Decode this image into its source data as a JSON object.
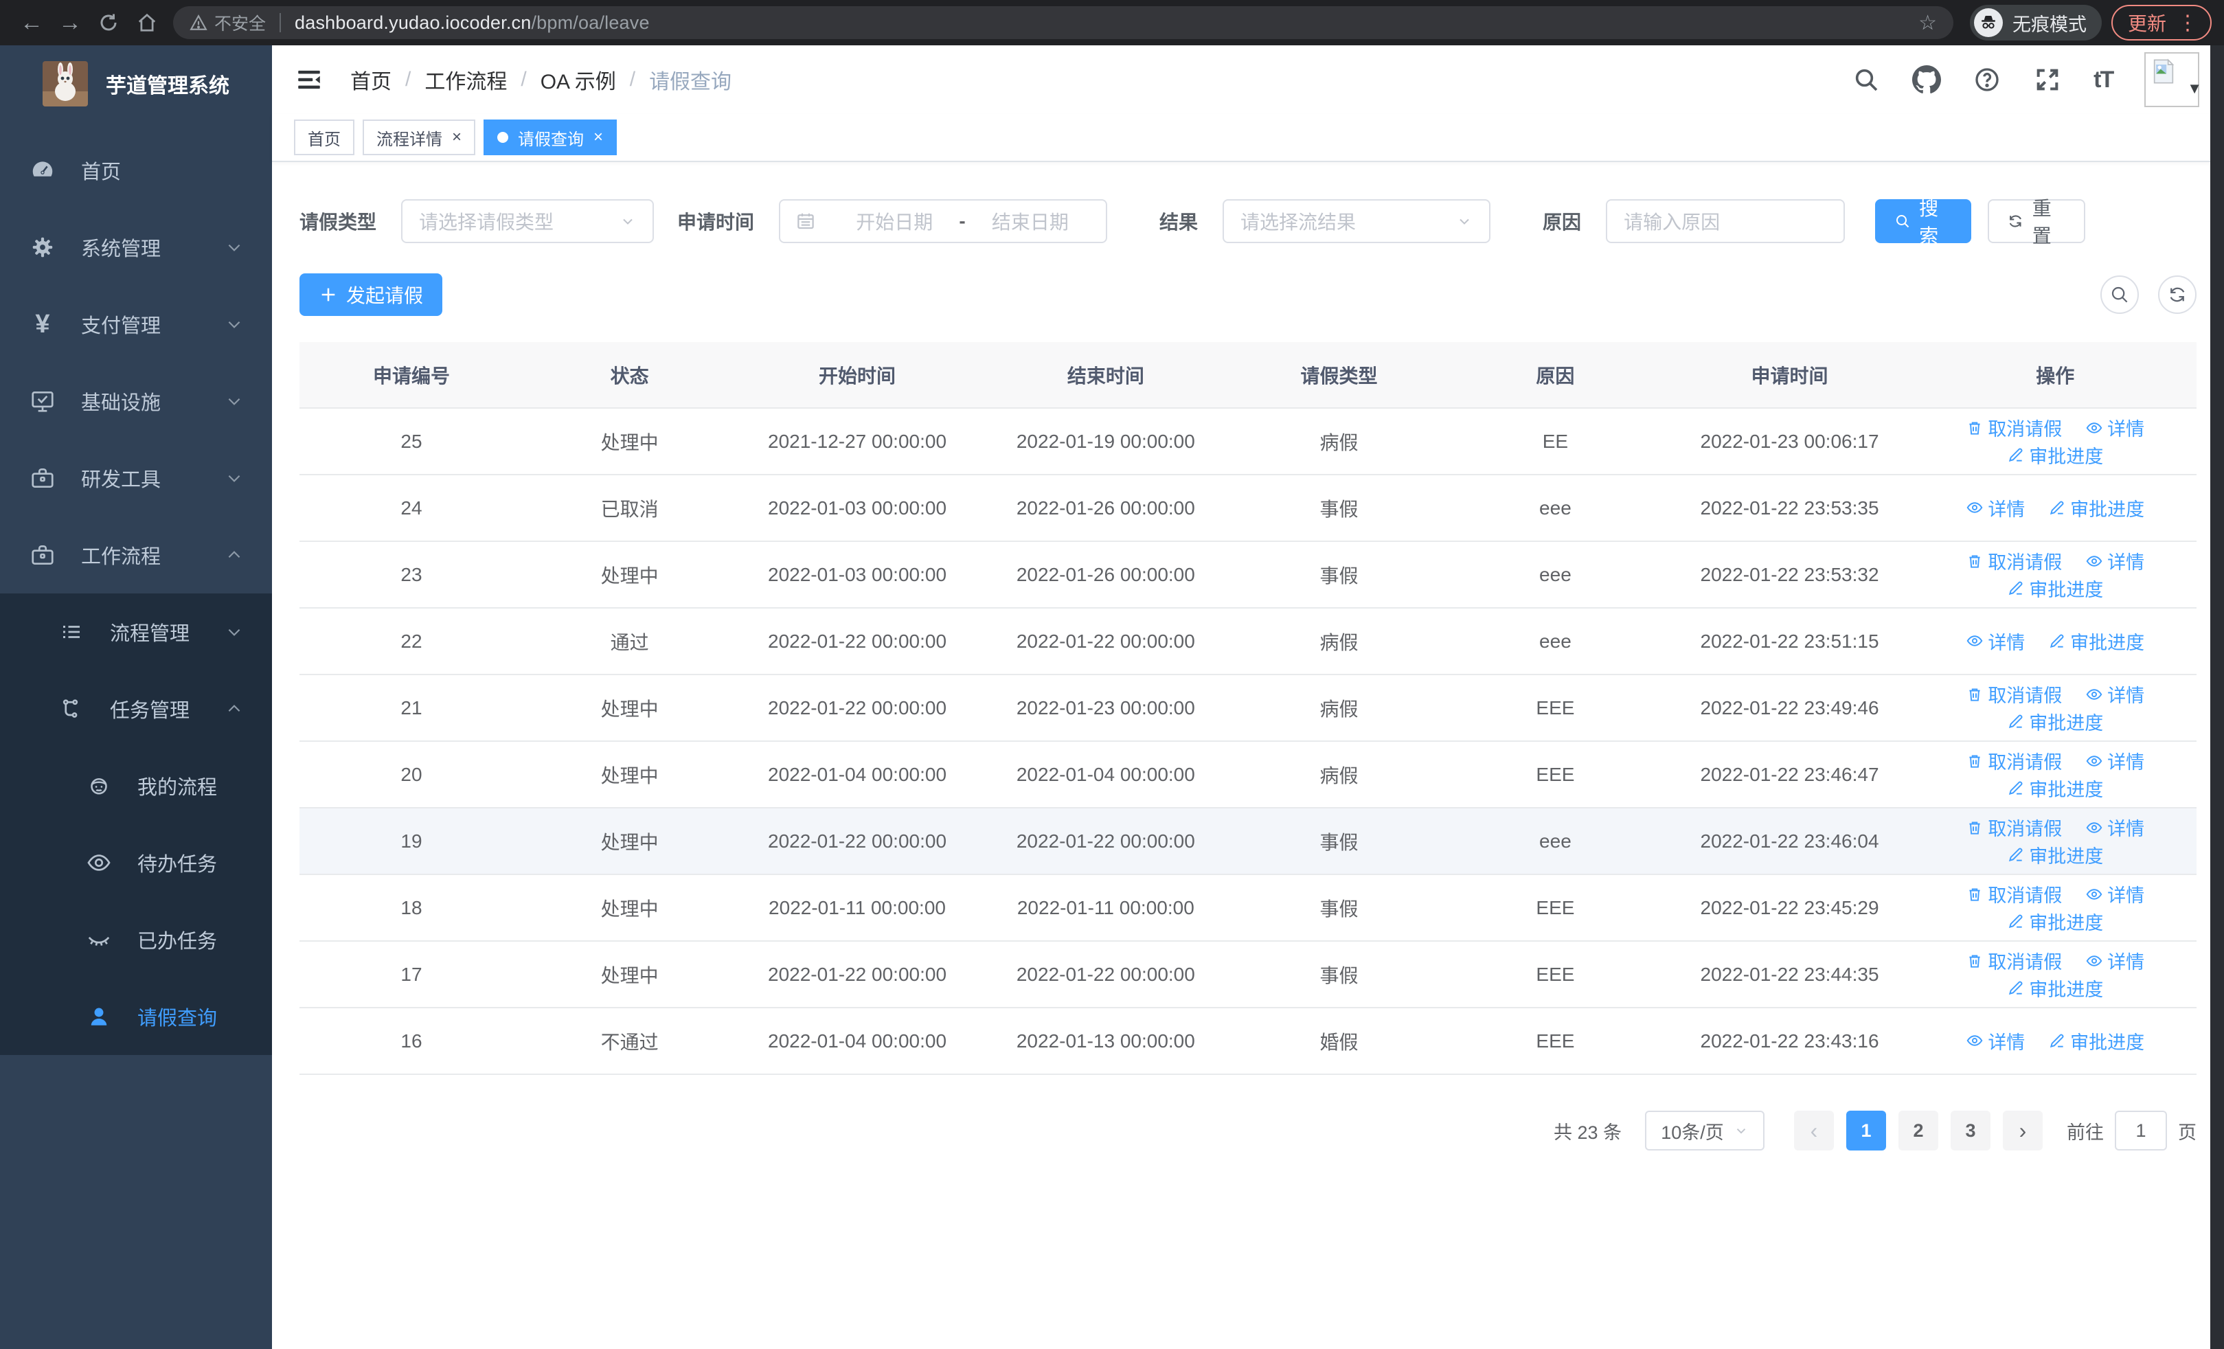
{
  "browser": {
    "security_label": "不安全",
    "url_host": "dashboard.yudao.iocoder.cn",
    "url_path": "/bpm/oa/leave",
    "incognito_label": "无痕模式",
    "update_label": "更新"
  },
  "sidebar": {
    "app_title": "芋道管理系统",
    "items": [
      {
        "label": "首页"
      },
      {
        "label": "系统管理"
      },
      {
        "label": "支付管理"
      },
      {
        "label": "基础设施"
      },
      {
        "label": "研发工具"
      },
      {
        "label": "工作流程"
      }
    ],
    "sub_items": [
      {
        "label": "流程管理"
      },
      {
        "label": "任务管理"
      }
    ],
    "leaf_items": [
      {
        "label": "我的流程"
      },
      {
        "label": "待办任务"
      },
      {
        "label": "已办任务"
      },
      {
        "label": "请假查询"
      }
    ]
  },
  "navbar": {
    "breadcrumb": [
      "首页",
      "工作流程",
      "OA 示例",
      "请假查询"
    ]
  },
  "tags": {
    "home": "首页",
    "detail": "流程详情",
    "leave": "请假查询"
  },
  "filters": {
    "leave_type_label": "请假类型",
    "leave_type_placeholder": "请选择请假类型",
    "apply_time_label": "申请时间",
    "start_placeholder": "开始日期",
    "range_separator": "-",
    "end_placeholder": "结束日期",
    "result_label": "结果",
    "result_placeholder": "请选择流结果",
    "reason_label": "原因",
    "reason_placeholder": "请输入原因",
    "search_label": "搜索",
    "reset_label": "重置"
  },
  "toolbar": {
    "create_label": "发起请假"
  },
  "table": {
    "columns": [
      "申请编号",
      "状态",
      "开始时间",
      "结束时间",
      "请假类型",
      "原因",
      "申请时间",
      "操作"
    ],
    "action_labels": {
      "cancel": "取消请假",
      "detail": "详情",
      "progress": "审批进度"
    },
    "rows": [
      {
        "id": "25",
        "status": "处理中",
        "start": "2021-12-27 00:00:00",
        "end": "2022-01-19 00:00:00",
        "type": "病假",
        "reason": "EE",
        "apply": "2022-01-23 00:06:17",
        "cancellable": true,
        "highlight": false
      },
      {
        "id": "24",
        "status": "已取消",
        "start": "2022-01-03 00:00:00",
        "end": "2022-01-26 00:00:00",
        "type": "事假",
        "reason": "eee",
        "apply": "2022-01-22 23:53:35",
        "cancellable": false,
        "highlight": false
      },
      {
        "id": "23",
        "status": "处理中",
        "start": "2022-01-03 00:00:00",
        "end": "2022-01-26 00:00:00",
        "type": "事假",
        "reason": "eee",
        "apply": "2022-01-22 23:53:32",
        "cancellable": true,
        "highlight": false
      },
      {
        "id": "22",
        "status": "通过",
        "start": "2022-01-22 00:00:00",
        "end": "2022-01-22 00:00:00",
        "type": "病假",
        "reason": "eee",
        "apply": "2022-01-22 23:51:15",
        "cancellable": false,
        "highlight": false
      },
      {
        "id": "21",
        "status": "处理中",
        "start": "2022-01-22 00:00:00",
        "end": "2022-01-23 00:00:00",
        "type": "病假",
        "reason": "EEE",
        "apply": "2022-01-22 23:49:46",
        "cancellable": true,
        "highlight": false
      },
      {
        "id": "20",
        "status": "处理中",
        "start": "2022-01-04 00:00:00",
        "end": "2022-01-04 00:00:00",
        "type": "病假",
        "reason": "EEE",
        "apply": "2022-01-22 23:46:47",
        "cancellable": true,
        "highlight": false
      },
      {
        "id": "19",
        "status": "处理中",
        "start": "2022-01-22 00:00:00",
        "end": "2022-01-22 00:00:00",
        "type": "事假",
        "reason": "eee",
        "apply": "2022-01-22 23:46:04",
        "cancellable": true,
        "highlight": true
      },
      {
        "id": "18",
        "status": "处理中",
        "start": "2022-01-11 00:00:00",
        "end": "2022-01-11 00:00:00",
        "type": "事假",
        "reason": "EEE",
        "apply": "2022-01-22 23:45:29",
        "cancellable": true,
        "highlight": false
      },
      {
        "id": "17",
        "status": "处理中",
        "start": "2022-01-22 00:00:00",
        "end": "2022-01-22 00:00:00",
        "type": "事假",
        "reason": "EEE",
        "apply": "2022-01-22 23:44:35",
        "cancellable": true,
        "highlight": false
      },
      {
        "id": "16",
        "status": "不通过",
        "start": "2022-01-04 00:00:00",
        "end": "2022-01-13 00:00:00",
        "type": "婚假",
        "reason": "EEE",
        "apply": "2022-01-22 23:43:16",
        "cancellable": false,
        "highlight": false
      }
    ]
  },
  "pagination": {
    "total": "共 23 条",
    "page_size": "10条/页",
    "pages": [
      "1",
      "2",
      "3"
    ],
    "active_page": "1",
    "goto_label": "前往",
    "goto_value": "1",
    "page_unit": "页"
  },
  "colors": {
    "accent": "#409eff",
    "sidebar_bg": "#304156",
    "sidebar_submenu_bg": "#1f2d3d",
    "chrome_bg": "#202124",
    "update_accent": "#f28b82",
    "table_header_bg": "#f8f8f9"
  }
}
